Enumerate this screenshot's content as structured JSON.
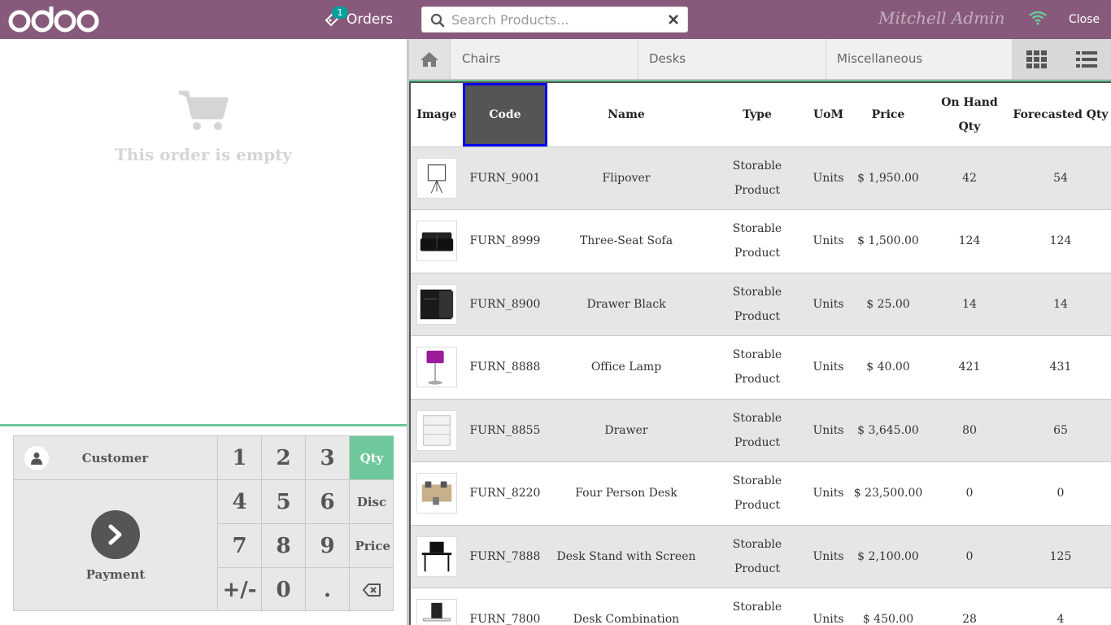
{
  "header": {
    "logo_text": "odoo",
    "orders_label": "Orders",
    "orders_count": "1",
    "search_placeholder": "Search Products...",
    "user_name": "Mitchell Admin",
    "close_label": "Close"
  },
  "order": {
    "empty_text": "This order is empty"
  },
  "numpad": {
    "customer_label": "Customer",
    "payment_label": "Payment",
    "keys": [
      "1",
      "2",
      "3",
      "4",
      "5",
      "6",
      "7",
      "8",
      "9",
      "+/-",
      "0",
      "."
    ],
    "modes": [
      "Qty",
      "Disc",
      "Price"
    ],
    "active_mode": "Qty"
  },
  "categories": [
    "Chairs",
    "Desks",
    "Miscellaneous"
  ],
  "table": {
    "headers": [
      "Image",
      "Code",
      "Name",
      "Type",
      "UoM",
      "Price",
      "On Hand Qty",
      "Forecasted Qty"
    ],
    "rows": [
      {
        "code": "FURN_9001",
        "name": "Flipover",
        "type": "Storable Product",
        "uom": "Units",
        "price": "$ 1,950.00",
        "on_hand": "42",
        "forecast": "54",
        "img": "flipover"
      },
      {
        "code": "FURN_8999",
        "name": "Three-Seat Sofa",
        "type": "Storable Product",
        "uom": "Units",
        "price": "$ 1,500.00",
        "on_hand": "124",
        "forecast": "124",
        "img": "sofa"
      },
      {
        "code": "FURN_8900",
        "name": "Drawer Black",
        "type": "Storable Product",
        "uom": "Units",
        "price": "$ 25.00",
        "on_hand": "14",
        "forecast": "14",
        "img": "drawer-black"
      },
      {
        "code": "FURN_8888",
        "name": "Office Lamp",
        "type": "Storable Product",
        "uom": "Units",
        "price": "$ 40.00",
        "on_hand": "421",
        "forecast": "431",
        "img": "lamp"
      },
      {
        "code": "FURN_8855",
        "name": "Drawer",
        "type": "Storable Product",
        "uom": "Units",
        "price": "$ 3,645.00",
        "on_hand": "80",
        "forecast": "65",
        "img": "drawer-white"
      },
      {
        "code": "FURN_8220",
        "name": "Four Person Desk",
        "type": "Storable Product",
        "uom": "Units",
        "price": "$ 23,500.00",
        "on_hand": "0",
        "forecast": "0",
        "img": "four-desk"
      },
      {
        "code": "FURN_7888",
        "name": "Desk Stand with Screen",
        "type": "Storable Product",
        "uom": "Units",
        "price": "$ 2,100.00",
        "on_hand": "0",
        "forecast": "125",
        "img": "desk-stand"
      },
      {
        "code": "FURN_7800",
        "name": "Desk Combination",
        "type": "Storable Product",
        "uom": "Units",
        "price": "$ 450.00",
        "on_hand": "28",
        "forecast": "4",
        "img": "desk-combo"
      }
    ]
  },
  "colors": {
    "brand": "#875a7b",
    "accent": "#6ec89b",
    "badge": "#00a09d"
  }
}
